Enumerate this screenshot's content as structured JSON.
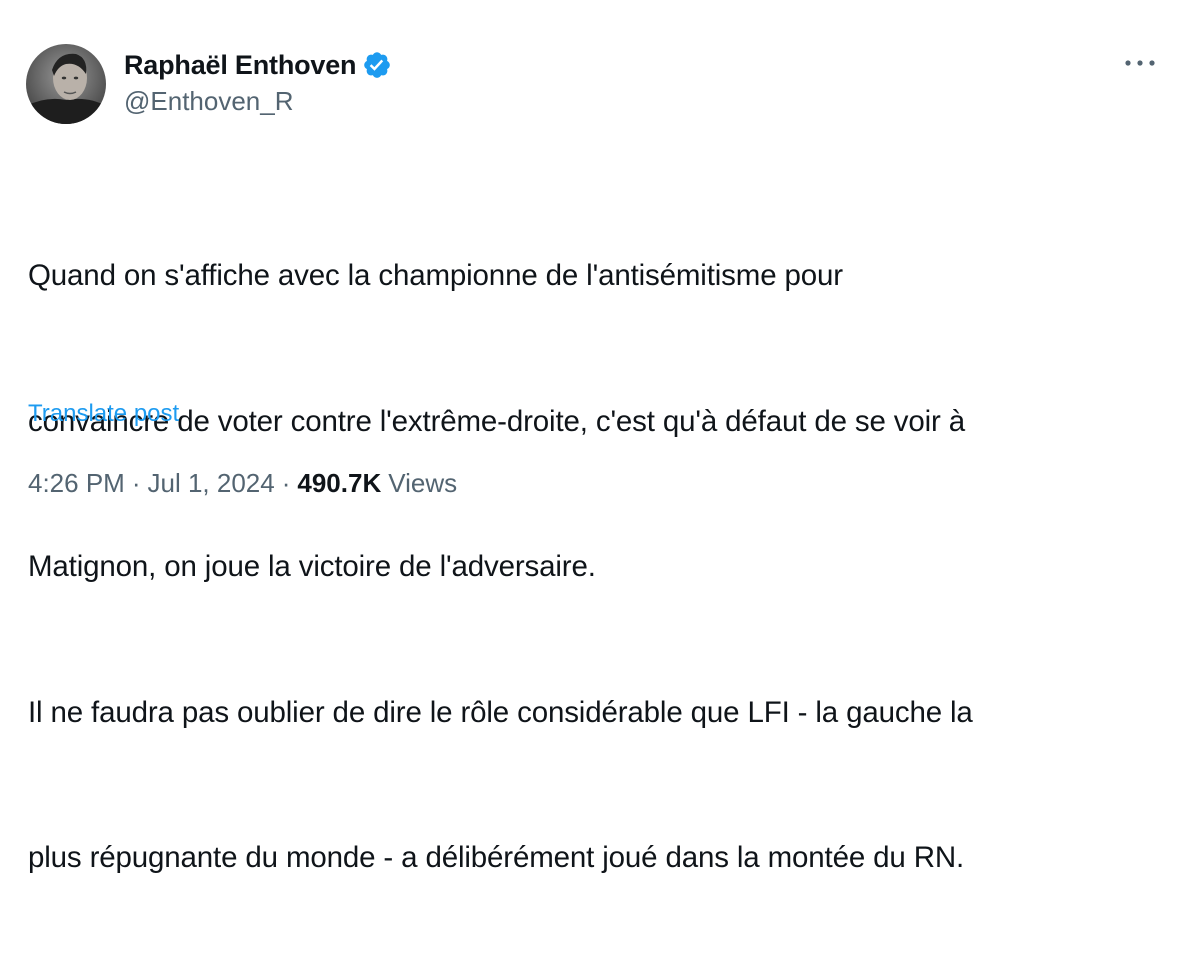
{
  "author": {
    "display_name": "Raphaël Enthoven",
    "handle": "@Enthoven_R",
    "verified": true
  },
  "tweet": {
    "lines": [
      "Quand on s'affiche avec la championne de l'antisémitisme pour",
      "convaincre de voter contre l'extrême-droite, c'est qu'à défaut de se voir à",
      "Matignon, on joue la victoire de l'adversaire.",
      "Il ne faudra pas oublier de dire le rôle considérable que LFI - la gauche la",
      "plus répugnante du monde - a délibérément joué dans la montée du RN."
    ],
    "translate_label": "Translate post"
  },
  "meta": {
    "time": "4:26 PM",
    "separator": "·",
    "date": "Jul 1, 2024",
    "views_count": "490.7K",
    "views_label": "Views"
  },
  "icons": {
    "more": "more-options-icon",
    "verified": "verified-badge-icon"
  },
  "colors": {
    "accent": "#1d9bf0",
    "text": "#0f1419",
    "secondary": "#536471"
  }
}
